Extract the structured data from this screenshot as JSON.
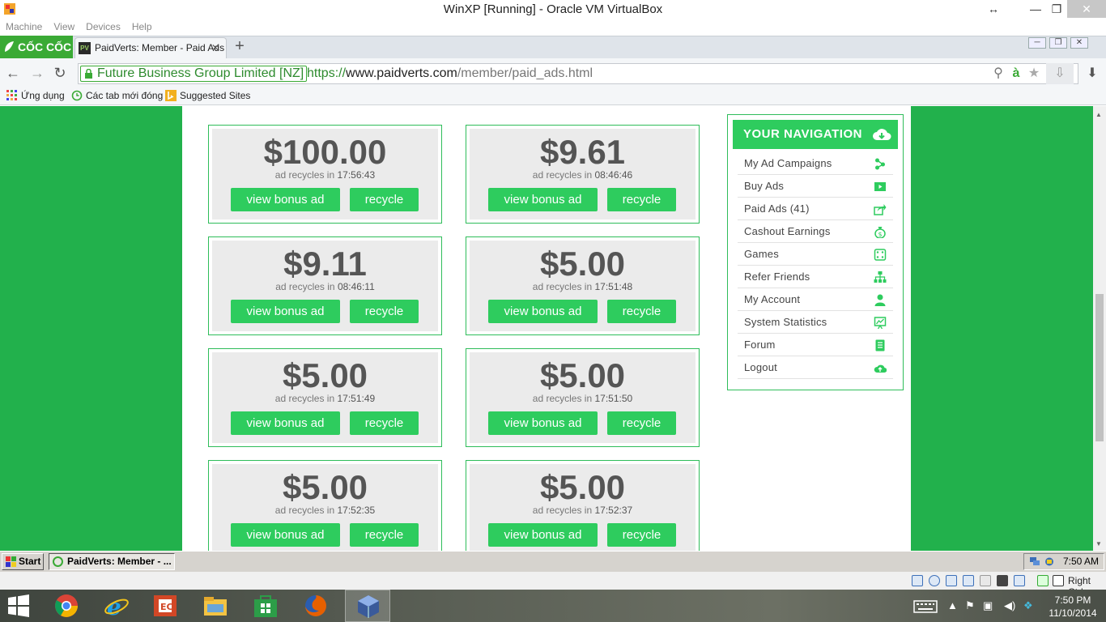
{
  "vbox": {
    "title": "WinXP [Running] - Oracle VM VirtualBox",
    "menu": [
      "Machine",
      "View",
      "Devices",
      "Help"
    ],
    "host_key": "Right Ctrl"
  },
  "browser": {
    "brand": "CỐC CỐC",
    "tab_title": "PaidVerts: Member - Paid Ads",
    "tab_favicon": "PV",
    "ev_cert": "Future Business Group Limited [NZ]",
    "url_scheme": "https://",
    "url_domain": "www.paidverts.com",
    "url_path": "/member/paid_ads.html",
    "bookmarks": [
      "Ứng dụng",
      "Các tab mới đóng",
      "Suggested Sites"
    ]
  },
  "ads": [
    {
      "amount": "$100.00",
      "recycle_label": "ad recycles in",
      "time": "17:56:43",
      "view_label": "view bonus ad",
      "recycle_btn": "recycle"
    },
    {
      "amount": "$9.61",
      "recycle_label": "ad recycles in",
      "time": "08:46:46",
      "view_label": "view bonus ad",
      "recycle_btn": "recycle"
    },
    {
      "amount": "$9.11",
      "recycle_label": "ad recycles in",
      "time": "08:46:11",
      "view_label": "view bonus ad",
      "recycle_btn": "recycle"
    },
    {
      "amount": "$5.00",
      "recycle_label": "ad recycles in",
      "time": "17:51:48",
      "view_label": "view bonus ad",
      "recycle_btn": "recycle"
    },
    {
      "amount": "$5.00",
      "recycle_label": "ad recycles in",
      "time": "17:51:49",
      "view_label": "view bonus ad",
      "recycle_btn": "recycle"
    },
    {
      "amount": "$5.00",
      "recycle_label": "ad recycles in",
      "time": "17:51:50",
      "view_label": "view bonus ad",
      "recycle_btn": "recycle"
    },
    {
      "amount": "$5.00",
      "recycle_label": "ad recycles in",
      "time": "17:52:35",
      "view_label": "view bonus ad",
      "recycle_btn": "recycle"
    },
    {
      "amount": "$5.00",
      "recycle_label": "ad recycles in",
      "time": "17:52:37",
      "view_label": "view bonus ad",
      "recycle_btn": "recycle"
    }
  ],
  "nav": {
    "heading": "YOUR NAVIGATION",
    "items": [
      {
        "label": "My Ad Campaigns",
        "icon": "share-icon"
      },
      {
        "label": "Buy Ads",
        "icon": "play-icon"
      },
      {
        "label": "Paid Ads (41)",
        "icon": "share-arrow-icon"
      },
      {
        "label": "Cashout Earnings",
        "icon": "money-bag-icon"
      },
      {
        "label": "Games",
        "icon": "dice-icon"
      },
      {
        "label": "Refer Friends",
        "icon": "sitemap-icon"
      },
      {
        "label": "My Account",
        "icon": "user-icon"
      },
      {
        "label": "System Statistics",
        "icon": "presentation-icon"
      },
      {
        "label": "Forum",
        "icon": "book-icon"
      },
      {
        "label": "Logout",
        "icon": "cloud-icon"
      }
    ]
  },
  "xp": {
    "start_label": "Start",
    "task_label": "PaidVerts: Member - ...",
    "clock": "7:50 AM"
  },
  "win": {
    "time": "7:50 PM",
    "date": "11/10/2014"
  },
  "colors": {
    "page_green": "#22b14c",
    "button_green": "#2ecc5e"
  }
}
